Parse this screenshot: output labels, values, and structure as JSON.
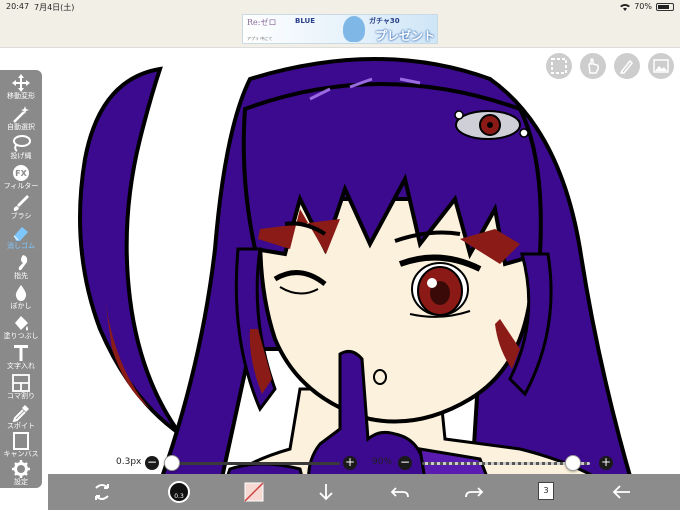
{
  "status": {
    "time": "20:47",
    "date": "7月4日(土)",
    "battery": "70%",
    "battery_level": 0.7
  },
  "ad": {
    "logo_left": "Re:ゼロ",
    "logo_mid": "BLUE",
    "title": "ガチャ30",
    "cta": "プレゼント",
    "fine_print": "アプリ 中にて"
  },
  "tools": [
    {
      "label": "移動変形",
      "icon": "move-icon"
    },
    {
      "label": "自動選択",
      "icon": "magic-wand-icon"
    },
    {
      "label": "投げ縄",
      "icon": "lasso-icon"
    },
    {
      "label": "フィルター",
      "icon": "filter-icon"
    },
    {
      "label": "ブラシ",
      "icon": "brush-icon"
    },
    {
      "label": "消しゴム",
      "icon": "eraser-icon",
      "active": true
    },
    {
      "label": "指先",
      "icon": "smudge-icon"
    },
    {
      "label": "ぼかし",
      "icon": "blur-icon"
    },
    {
      "label": "塗りつぶし",
      "icon": "fill-icon"
    },
    {
      "label": "文字入れ",
      "icon": "text-icon"
    },
    {
      "label": "コマ割り",
      "icon": "panel-icon"
    },
    {
      "label": "スポイト",
      "icon": "eyedropper-icon"
    },
    {
      "label": "キャンバス",
      "icon": "canvas-icon"
    },
    {
      "label": "設定",
      "icon": "gear-icon"
    }
  ],
  "controls": {
    "brush_size": "0.3px",
    "brush_size_level": 0.0,
    "opacity": "90%",
    "opacity_level": 0.9,
    "minus_glyph": "−",
    "plus_glyph": "+"
  },
  "bottom": {
    "color_value": "0.3",
    "layer_count": "3",
    "icons": [
      "transform-icon",
      "color-icon",
      "secondary-color-icon",
      "import-icon",
      "undo-icon",
      "redo-icon",
      "layer-icon",
      "back-icon"
    ]
  },
  "view_icons": [
    "selection-icon",
    "hand-icon",
    "pen-icon",
    "gallery-icon"
  ],
  "colors": {
    "hair": "#3c0a8e",
    "hair_shadow": "#8a1b16",
    "skin": "#fbf1dc",
    "eye": "#8b1a16",
    "toolbar": "#8a8a8a",
    "active_tool": "#7ec8ff"
  }
}
